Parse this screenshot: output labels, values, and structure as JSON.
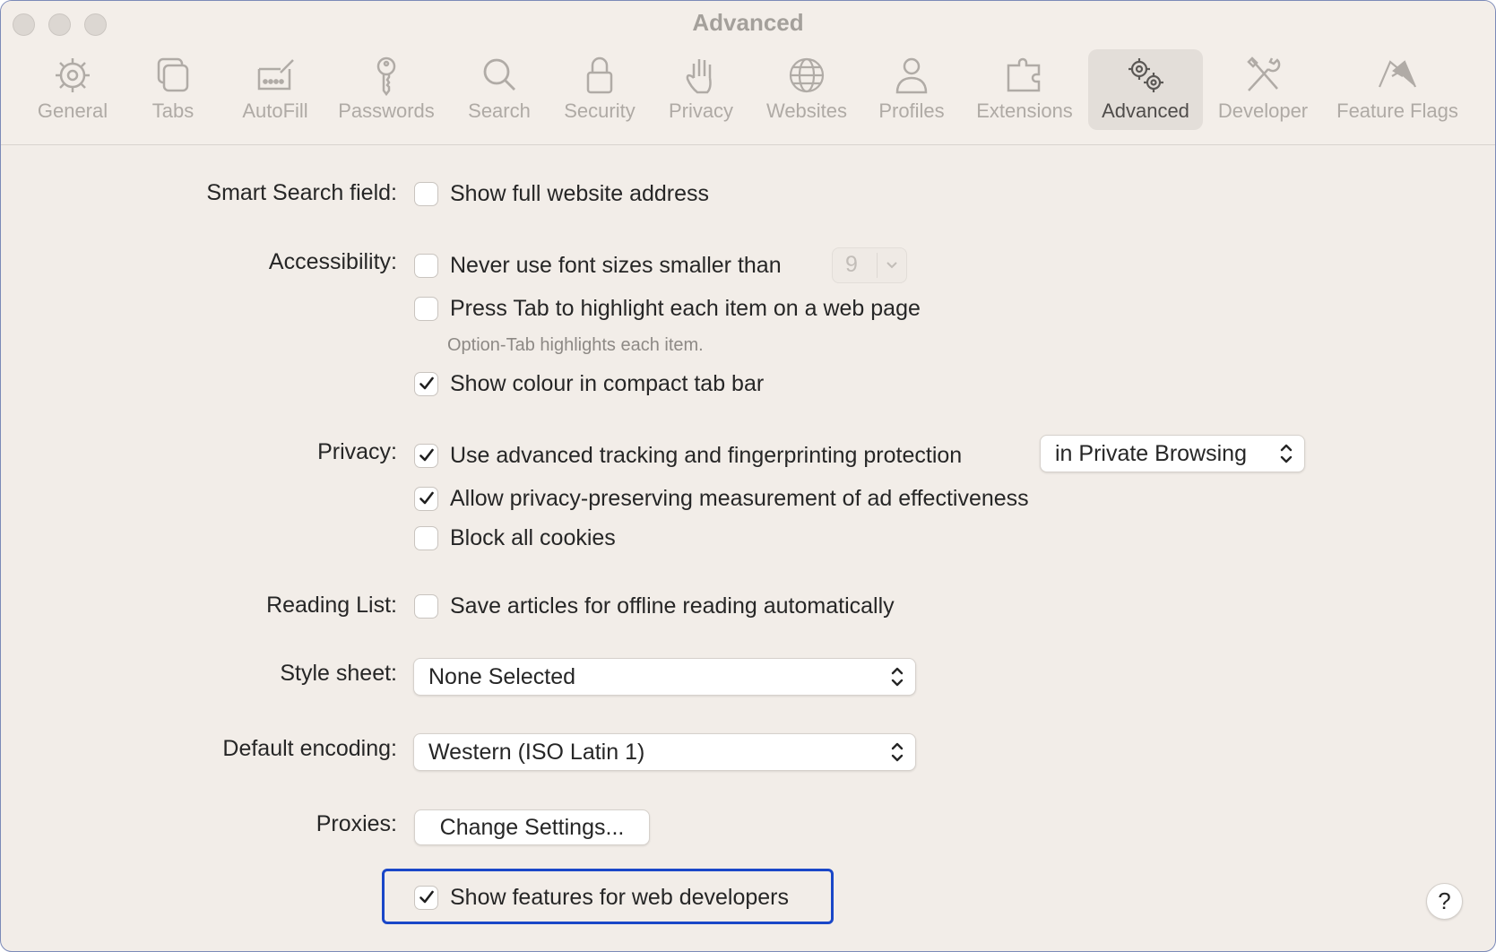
{
  "window": {
    "title": "Advanced"
  },
  "toolbar": {
    "tabs": [
      {
        "label": "General",
        "icon": "gear-icon"
      },
      {
        "label": "Tabs",
        "icon": "tabs-icon"
      },
      {
        "label": "AutoFill",
        "icon": "autofill-icon"
      },
      {
        "label": "Passwords",
        "icon": "key-icon"
      },
      {
        "label": "Search",
        "icon": "search-icon"
      },
      {
        "label": "Security",
        "icon": "lock-icon"
      },
      {
        "label": "Privacy",
        "icon": "hand-icon"
      },
      {
        "label": "Websites",
        "icon": "globe-icon"
      },
      {
        "label": "Profiles",
        "icon": "person-icon"
      },
      {
        "label": "Extensions",
        "icon": "puzzle-icon"
      },
      {
        "label": "Advanced",
        "icon": "gears-icon",
        "selected": true
      },
      {
        "label": "Developer",
        "icon": "tools-icon"
      },
      {
        "label": "Feature Flags",
        "icon": "flags-icon"
      }
    ]
  },
  "settings": {
    "smart_search": {
      "label": "Smart Search field:",
      "full_address": {
        "text": "Show full website address",
        "checked": false
      }
    },
    "accessibility": {
      "label": "Accessibility:",
      "min_font": {
        "text": "Never use font sizes smaller than",
        "checked": false,
        "value": "9"
      },
      "press_tab": {
        "text": "Press Tab to highlight each item on a web page",
        "checked": false
      },
      "hint": "Option-Tab highlights each item.",
      "tab_colour": {
        "text": "Show colour in compact tab bar",
        "checked": true
      }
    },
    "privacy": {
      "label": "Privacy:",
      "tracking": {
        "text": "Use advanced tracking and fingerprinting protection",
        "checked": true,
        "mode": "in Private Browsing"
      },
      "ad_measurement": {
        "text": "Allow privacy-preserving measurement of ad effectiveness",
        "checked": true
      },
      "block_cookies": {
        "text": "Block all cookies",
        "checked": false
      }
    },
    "reading_list": {
      "label": "Reading List:",
      "offline": {
        "text": "Save articles for offline reading automatically",
        "checked": false
      }
    },
    "style_sheet": {
      "label": "Style sheet:",
      "value": "None Selected"
    },
    "encoding": {
      "label": "Default encoding:",
      "value": "Western (ISO Latin 1)"
    },
    "proxies": {
      "label": "Proxies:",
      "button": "Change Settings..."
    },
    "developer": {
      "text": "Show features for web developers",
      "checked": true
    }
  },
  "help": {
    "label": "?"
  },
  "colors": {
    "highlight_border": "#1a47c8",
    "window_bg": "#f2ede8",
    "text": "#262626"
  }
}
